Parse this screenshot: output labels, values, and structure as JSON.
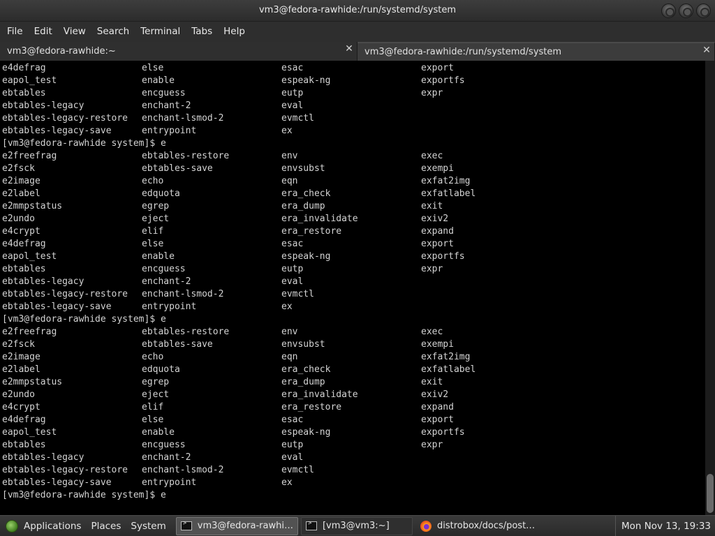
{
  "window": {
    "title": "vm3@fedora-rawhide:/run/systemd/system"
  },
  "menu": [
    "File",
    "Edit",
    "View",
    "Search",
    "Terminal",
    "Tabs",
    "Help"
  ],
  "tabs": [
    {
      "label": "vm3@fedora-rawhide:~",
      "active": false
    },
    {
      "label": "vm3@fedora-rawhide:/run/systemd/system",
      "active": true
    }
  ],
  "terminal": {
    "lines": [
      [
        "e4defrag",
        "else",
        "esac",
        "export"
      ],
      [
        "eapol_test",
        "enable",
        "espeak-ng",
        "exportfs"
      ],
      [
        "ebtables",
        "encguess",
        "eutp",
        "expr"
      ],
      [
        "ebtables-legacy",
        "enchant-2",
        "eval",
        ""
      ],
      [
        "ebtables-legacy-restore",
        "enchant-lsmod-2",
        "evmctl",
        ""
      ],
      [
        "ebtables-legacy-save",
        "entrypoint",
        "ex",
        ""
      ],
      [
        "[vm3@fedora-rawhide system]$ e"
      ],
      [
        "e2freefrag",
        "ebtables-restore",
        "env",
        "exec"
      ],
      [
        "e2fsck",
        "ebtables-save",
        "envsubst",
        "exempi"
      ],
      [
        "e2image",
        "echo",
        "eqn",
        "exfat2img"
      ],
      [
        "e2label",
        "edquota",
        "era_check",
        "exfatlabel"
      ],
      [
        "e2mmpstatus",
        "egrep",
        "era_dump",
        "exit"
      ],
      [
        "e2undo",
        "eject",
        "era_invalidate",
        "exiv2"
      ],
      [
        "e4crypt",
        "elif",
        "era_restore",
        "expand"
      ],
      [
        "e4defrag",
        "else",
        "esac",
        "export"
      ],
      [
        "eapol_test",
        "enable",
        "espeak-ng",
        "exportfs"
      ],
      [
        "ebtables",
        "encguess",
        "eutp",
        "expr"
      ],
      [
        "ebtables-legacy",
        "enchant-2",
        "eval",
        ""
      ],
      [
        "ebtables-legacy-restore",
        "enchant-lsmod-2",
        "evmctl",
        ""
      ],
      [
        "ebtables-legacy-save",
        "entrypoint",
        "ex",
        ""
      ],
      [
        "[vm3@fedora-rawhide system]$ e"
      ],
      [
        "e2freefrag",
        "ebtables-restore",
        "env",
        "exec"
      ],
      [
        "e2fsck",
        "ebtables-save",
        "envsubst",
        "exempi"
      ],
      [
        "e2image",
        "echo",
        "eqn",
        "exfat2img"
      ],
      [
        "e2label",
        "edquota",
        "era_check",
        "exfatlabel"
      ],
      [
        "e2mmpstatus",
        "egrep",
        "era_dump",
        "exit"
      ],
      [
        "e2undo",
        "eject",
        "era_invalidate",
        "exiv2"
      ],
      [
        "e4crypt",
        "elif",
        "era_restore",
        "expand"
      ],
      [
        "e4defrag",
        "else",
        "esac",
        "export"
      ],
      [
        "eapol_test",
        "enable",
        "espeak-ng",
        "exportfs"
      ],
      [
        "ebtables",
        "encguess",
        "eutp",
        "expr"
      ],
      [
        "ebtables-legacy",
        "enchant-2",
        "eval",
        ""
      ],
      [
        "ebtables-legacy-restore",
        "enchant-lsmod-2",
        "evmctl",
        ""
      ],
      [
        "ebtables-legacy-save",
        "entrypoint",
        "ex",
        ""
      ],
      [
        "[vm3@fedora-rawhide system]$ e"
      ]
    ]
  },
  "taskbar": {
    "applications": "Applications",
    "places": "Places",
    "system": "System",
    "tasks": [
      {
        "label": "vm3@fedora-rawhi…",
        "icon": "terminal-icon",
        "active": true
      },
      {
        "label": "[vm3@vm3:~]",
        "icon": "terminal-icon",
        "active": false
      },
      {
        "label": "distrobox/docs/post…",
        "icon": "firefox-icon",
        "active": false
      }
    ],
    "clock": "Mon Nov 13, 19:33"
  },
  "colors": {
    "terminal_bg": "#000000",
    "terminal_fg": "#d3d3d3",
    "chrome_bg": "#2e2e2e"
  }
}
